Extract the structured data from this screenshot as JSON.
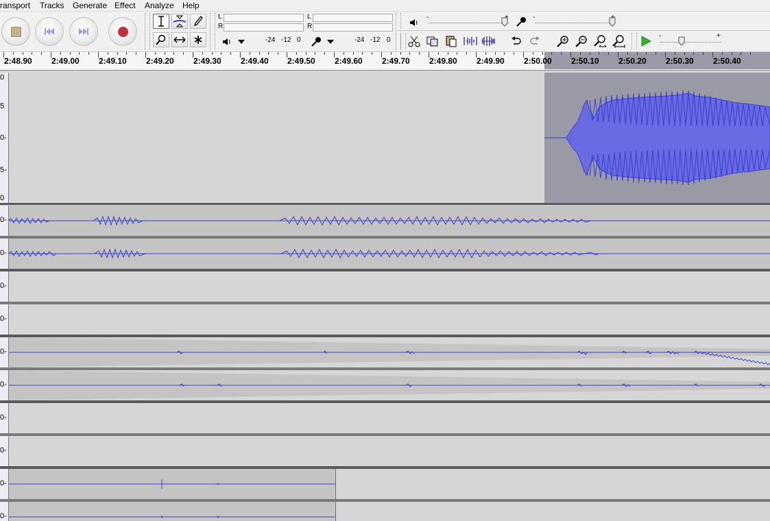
{
  "menubar": {
    "items": [
      {
        "label": "ransport"
      },
      {
        "label": "Tracks"
      },
      {
        "label": "Generate"
      },
      {
        "label": "Effect"
      },
      {
        "label": "Analyze"
      },
      {
        "label": "Help"
      }
    ]
  },
  "meters": {
    "play": {
      "left_label": "L",
      "right_label": "R",
      "scale": [
        "-24",
        "-12",
        "0"
      ]
    },
    "record": {
      "left_label": "L",
      "right_label": "R",
      "scale": [
        "-24",
        "-12",
        "0"
      ]
    }
  },
  "mixer": {
    "minus_label": "-",
    "plus_label": "+",
    "play_volume_level": 0.95,
    "record_volume_level": 0.97
  },
  "play_at_speed": {
    "minus_label": "-",
    "plus_label": "+",
    "speed_level": 0.35
  },
  "ruler": {
    "labels": [
      "2:48.90",
      "2:49.00",
      "2:49.10",
      "2:49.20",
      "2:49.30",
      "2:49.40",
      "2:49.50",
      "2:49.60",
      "2:49.70",
      "2:49.80",
      "2:49.90",
      "2:50.00",
      "2:50.10",
      "2:50.20",
      "2:50.30",
      "2:50.40"
    ]
  },
  "tracks": {
    "first": {
      "ticks": [
        "0",
        "5",
        "0-",
        "5-",
        "0"
      ]
    },
    "zero_tick": "0-"
  },
  "colors": {
    "waveform": "#3b3fd0",
    "waveform_fill": "#6a6ae2",
    "selection": "#9a9aa6",
    "track_bg": "#d6d6d6",
    "clip_bg": "#c4c4c4",
    "play_green": "#2fb52f",
    "record_red": "#c0303a"
  }
}
